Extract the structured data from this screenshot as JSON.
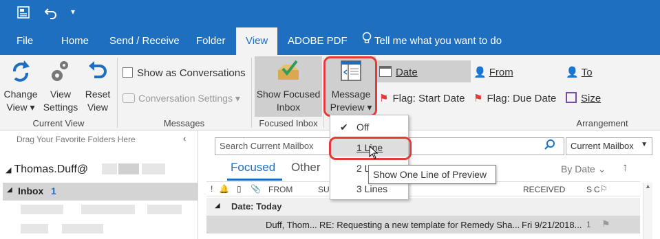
{
  "colors": {
    "accent": "#1e6fbf",
    "highlight": "#e53935",
    "ribbon": "#f3f3f3"
  },
  "tabs": [
    "File",
    "Home",
    "Send / Receive",
    "Folder",
    "View",
    "ADOBE PDF"
  ],
  "tell_me": "Tell me what you want to do",
  "ribbon": {
    "change_view": {
      "line1": "Change",
      "line2": "View ▾"
    },
    "view_settings": {
      "line1": "View",
      "line2": "Settings"
    },
    "reset_view": {
      "line1": "Reset",
      "line2": "View"
    },
    "current_view_label": "Current View",
    "show_as_conversations": "Show as Conversations",
    "conversation_settings": "Conversation Settings ▾",
    "messages_label": "Messages",
    "show_focused_inbox": {
      "line1": "Show Focused",
      "line2": "Inbox"
    },
    "focused_inbox_label": "Focused Inbox",
    "message_preview": {
      "line1": "Message",
      "line2": "Preview ▾"
    },
    "arrangement": {
      "date": "Date",
      "from": "From",
      "to": "To",
      "flag_start": "Flag: Start Date",
      "flag_due": "Flag: Due Date",
      "size": "Size"
    },
    "arrangement_label": "Arrangement"
  },
  "nav": {
    "favorites_hint": "Drag Your Favorite Folders Here",
    "account": "Thomas.Duff@",
    "inbox_label": "Inbox",
    "inbox_count": "1"
  },
  "list": {
    "search_placeholder": "Search Current Mailbox",
    "scope": "Current Mailbox",
    "tab_focused": "Focused",
    "tab_other": "Other",
    "sort": "By Date",
    "col_from": "FROM",
    "col_subject": "SU",
    "col_received": "RECEIVED",
    "group_header": "Date: Today",
    "row": {
      "from": "Duff, Thom...",
      "subject": "RE: Requesting a new template for Remedy Sha...",
      "received": "Fri 9/21/2018...",
      "count": "1"
    }
  },
  "dropdown": {
    "items": [
      "Off",
      "1 Line",
      "2 Lines",
      "3 Lines"
    ],
    "checked": "Off",
    "tooltip": "Show One Line of Preview"
  }
}
